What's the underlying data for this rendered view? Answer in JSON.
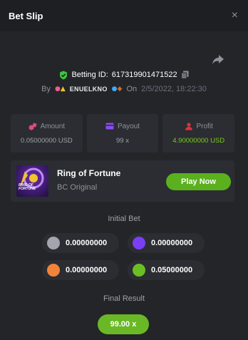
{
  "header": {
    "title": "Bet Slip",
    "close_symbol": "×"
  },
  "bet_info": {
    "betting_id_label": "Betting ID:",
    "betting_id": "617319901471522",
    "by_label": "By",
    "username": "ENUELKNO",
    "on_label": "On",
    "date": "2/5/2022, 18:22:30"
  },
  "stats": {
    "amount": {
      "label": "Amount",
      "value": "0.05000000 USD"
    },
    "payout": {
      "label": "Payout",
      "value": "99 x"
    },
    "profit": {
      "label": "Profit",
      "value": "4.90000000 USD"
    }
  },
  "game": {
    "name": "Ring of Fortune",
    "provider": "BC Original",
    "play_label": "Play Now",
    "thumbnail_text_line1": "RING OF",
    "thumbnail_text_line2": "FORTUNE"
  },
  "initial_bet": {
    "title": "Initial Bet",
    "bets": [
      {
        "color": "#a3a6ad",
        "value": "0.00000000"
      },
      {
        "color": "#7b3ff2",
        "value": "0.00000000"
      },
      {
        "color": "#f2843a",
        "value": "0.00000000"
      },
      {
        "color": "#6cbf22",
        "value": "0.05000000"
      }
    ]
  },
  "final_result": {
    "title": "Final Result",
    "value": "99.00 x"
  },
  "colors": {
    "accent_green": "#5bb01e",
    "profit_green": "#7acb1f",
    "panel": "#2b2d32",
    "background": "#232529"
  }
}
